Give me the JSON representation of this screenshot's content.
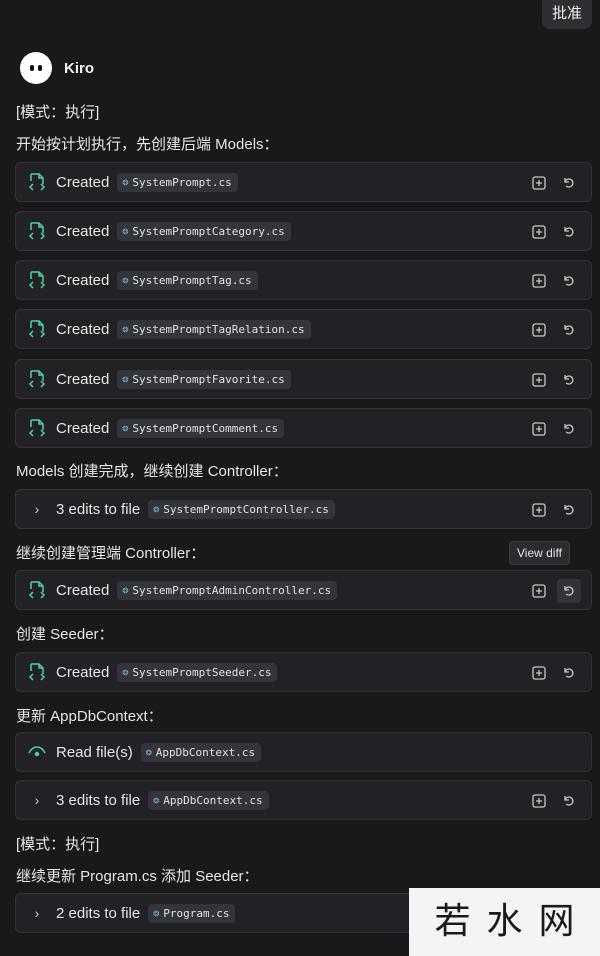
{
  "header": {
    "approve_label": "批准"
  },
  "agent": {
    "name": "Kiro"
  },
  "messages": [
    {
      "text": "[模式：执行]"
    },
    {
      "text": "开始按计划执行，先创建后端 Models："
    },
    {
      "text": "Models 创建完成，继续创建 Controller："
    },
    {
      "text": "继续创建管理端 Controller："
    },
    {
      "text": "创建 Seeder："
    },
    {
      "text": "更新 AppDbContext："
    },
    {
      "text": "[模式：执行]"
    },
    {
      "text": "继续更新 Program.cs 添加 Seeder："
    }
  ],
  "cards": [
    {
      "kind": "created",
      "label": "Created",
      "file": "SystemPrompt.cs"
    },
    {
      "kind": "created",
      "label": "Created",
      "file": "SystemPromptCategory.cs"
    },
    {
      "kind": "created",
      "label": "Created",
      "file": "SystemPromptTag.cs"
    },
    {
      "kind": "created",
      "label": "Created",
      "file": "SystemPromptTagRelation.cs"
    },
    {
      "kind": "created",
      "label": "Created",
      "file": "SystemPromptFavorite.cs"
    },
    {
      "kind": "created",
      "label": "Created",
      "file": "SystemPromptComment.cs"
    },
    {
      "kind": "edits",
      "label": "3 edits to file",
      "file": "SystemPromptController.cs"
    },
    {
      "kind": "created",
      "label": "Created",
      "file": "SystemPromptAdminController.cs"
    },
    {
      "kind": "created",
      "label": "Created",
      "file": "SystemPromptSeeder.cs"
    },
    {
      "kind": "read",
      "label": "Read file(s)",
      "file": "AppDbContext.cs"
    },
    {
      "kind": "edits",
      "label": "3 edits to file",
      "file": "AppDbContext.cs"
    },
    {
      "kind": "edits",
      "label": "2 edits to file",
      "file": "Program.cs"
    }
  ],
  "tooltip": {
    "text": "View diff"
  },
  "watermark": {
    "title": "若水网"
  },
  "colors": {
    "accent_green": "#4fd1a5",
    "accent_blue": "#7cb8d6",
    "background": "#19191c",
    "card": "#222226"
  },
  "icons": {
    "created": "file-code-icon",
    "read": "eye-icon",
    "edits": "chevron-right-icon",
    "diff": "view-diff-icon",
    "revert": "undo-icon"
  }
}
